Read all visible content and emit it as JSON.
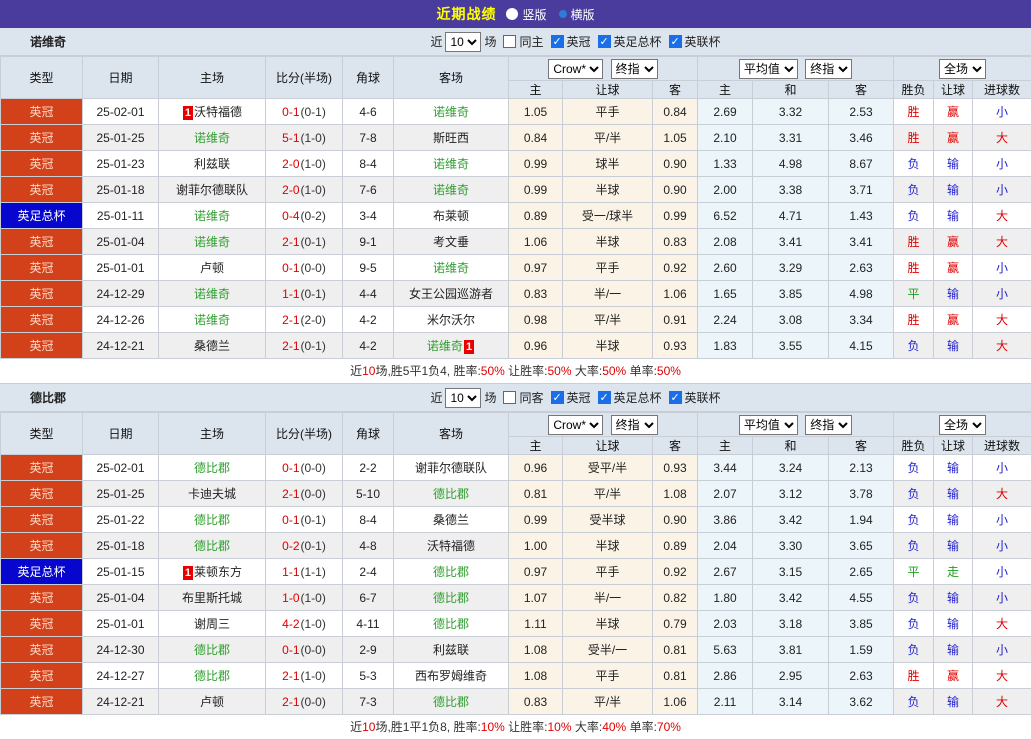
{
  "colors": {
    "topbar_purple": "#4a3c9c",
    "title_yellow": "#ffff00",
    "league_badge": "#d2411a",
    "cup_badge": "#0606cf",
    "self_team_green": "#2f9e2f",
    "win_red": "#e00000",
    "lose_blue": "#2222cc",
    "draw_green": "#1f9e1f",
    "header_bg": "#dce4ee",
    "asia_col_bg": "#fbf4e6",
    "euro_col_bg": "#ecf5f9"
  },
  "topbar": {
    "title": "近期战绩",
    "radios": [
      {
        "label": "竖版",
        "checked": false
      },
      {
        "label": "横版",
        "checked": true
      }
    ]
  },
  "tables": [
    {
      "team": "诺维奇",
      "filter": {
        "near": "近",
        "count": "10",
        "unit": "场",
        "same": "同主",
        "leagues": [
          "英冠",
          "英足总杯",
          "英联杯"
        ]
      },
      "dropdowns": [
        "Crow*",
        "终指",
        "平均值",
        "终指",
        "全场"
      ],
      "main_headers": [
        "类型",
        "日期",
        "主场",
        "比分(半场)",
        "角球",
        "客场"
      ],
      "sub_headers": [
        "主",
        "让球",
        "客",
        "主",
        "和",
        "客",
        "胜负",
        "让球",
        "进球数"
      ],
      "rows": [
        {
          "league": "英冠",
          "cup": false,
          "date": "25-02-01",
          "home": {
            "name": "沃特福德",
            "self": false,
            "badge": "1",
            "badge_pos": "before"
          },
          "score": {
            "ft": "0-1",
            "ht": "(0-1)"
          },
          "corner": "4-6",
          "away": {
            "name": "诺维奇",
            "self": true
          },
          "asia": [
            "1.05",
            "平手",
            "0.84"
          ],
          "euro": [
            "2.69",
            "3.32",
            "2.53"
          ],
          "result": [
            "胜",
            "赢",
            "小"
          ]
        },
        {
          "league": "英冠",
          "cup": false,
          "date": "25-01-25",
          "home": {
            "name": "诺维奇",
            "self": true
          },
          "score": {
            "ft": "5-1",
            "ht": "(1-0)"
          },
          "corner": "7-8",
          "away": {
            "name": "斯旺西",
            "self": false
          },
          "asia": [
            "0.84",
            "平/半",
            "1.05"
          ],
          "euro": [
            "2.10",
            "3.31",
            "3.46"
          ],
          "result": [
            "胜",
            "赢",
            "大"
          ]
        },
        {
          "league": "英冠",
          "cup": false,
          "date": "25-01-23",
          "home": {
            "name": "利兹联",
            "self": false
          },
          "score": {
            "ft": "2-0",
            "ht": "(1-0)"
          },
          "corner": "8-4",
          "away": {
            "name": "诺维奇",
            "self": true
          },
          "asia": [
            "0.99",
            "球半",
            "0.90"
          ],
          "euro": [
            "1.33",
            "4.98",
            "8.67"
          ],
          "result": [
            "负",
            "输",
            "小"
          ]
        },
        {
          "league": "英冠",
          "cup": false,
          "date": "25-01-18",
          "home": {
            "name": "谢菲尔德联队",
            "self": false
          },
          "score": {
            "ft": "2-0",
            "ht": "(1-0)"
          },
          "corner": "7-6",
          "away": {
            "name": "诺维奇",
            "self": true
          },
          "asia": [
            "0.99",
            "半球",
            "0.90"
          ],
          "euro": [
            "2.00",
            "3.38",
            "3.71"
          ],
          "result": [
            "负",
            "输",
            "小"
          ]
        },
        {
          "league": "英足总杯",
          "cup": true,
          "date": "25-01-11",
          "home": {
            "name": "诺维奇",
            "self": true
          },
          "score": {
            "ft": "0-4",
            "ht": "(0-2)"
          },
          "corner": "3-4",
          "away": {
            "name": "布莱顿",
            "self": false
          },
          "asia": [
            "0.89",
            "受一/球半",
            "0.99"
          ],
          "euro": [
            "6.52",
            "4.71",
            "1.43"
          ],
          "result": [
            "负",
            "输",
            "大"
          ]
        },
        {
          "league": "英冠",
          "cup": false,
          "date": "25-01-04",
          "home": {
            "name": "诺维奇",
            "self": true
          },
          "score": {
            "ft": "2-1",
            "ht": "(0-1)"
          },
          "corner": "9-1",
          "away": {
            "name": "考文垂",
            "self": false
          },
          "asia": [
            "1.06",
            "半球",
            "0.83"
          ],
          "euro": [
            "2.08",
            "3.41",
            "3.41"
          ],
          "result": [
            "胜",
            "赢",
            "大"
          ]
        },
        {
          "league": "英冠",
          "cup": false,
          "date": "25-01-01",
          "home": {
            "name": "卢顿",
            "self": false
          },
          "score": {
            "ft": "0-1",
            "ht": "(0-0)"
          },
          "corner": "9-5",
          "away": {
            "name": "诺维奇",
            "self": true
          },
          "asia": [
            "0.97",
            "平手",
            "0.92"
          ],
          "euro": [
            "2.60",
            "3.29",
            "2.63"
          ],
          "result": [
            "胜",
            "赢",
            "小"
          ]
        },
        {
          "league": "英冠",
          "cup": false,
          "date": "24-12-29",
          "home": {
            "name": "诺维奇",
            "self": true
          },
          "score": {
            "ft": "1-1",
            "ht": "(0-1)"
          },
          "corner": "4-4",
          "away": {
            "name": "女王公园巡游者",
            "self": false
          },
          "asia": [
            "0.83",
            "半/一",
            "1.06"
          ],
          "euro": [
            "1.65",
            "3.85",
            "4.98"
          ],
          "result": [
            "平",
            "输",
            "小"
          ]
        },
        {
          "league": "英冠",
          "cup": false,
          "date": "24-12-26",
          "home": {
            "name": "诺维奇",
            "self": true
          },
          "score": {
            "ft": "2-1",
            "ht": "(2-0)"
          },
          "corner": "4-2",
          "away": {
            "name": "米尔沃尔",
            "self": false
          },
          "asia": [
            "0.98",
            "平/半",
            "0.91"
          ],
          "euro": [
            "2.24",
            "3.08",
            "3.34"
          ],
          "result": [
            "胜",
            "赢",
            "大"
          ]
        },
        {
          "league": "英冠",
          "cup": false,
          "date": "24-12-21",
          "home": {
            "name": "桑德兰",
            "self": false
          },
          "score": {
            "ft": "2-1",
            "ht": "(0-1)"
          },
          "corner": "4-2",
          "away": {
            "name": "诺维奇",
            "self": true,
            "badge": "1",
            "badge_pos": "after"
          },
          "asia": [
            "0.96",
            "半球",
            "0.93"
          ],
          "euro": [
            "1.83",
            "3.55",
            "4.15"
          ],
          "result": [
            "负",
            "输",
            "大"
          ]
        }
      ],
      "summary": [
        {
          "text": "近",
          "red": false
        },
        {
          "text": "10",
          "red": true
        },
        {
          "text": "场,胜5平1负4, 胜率:",
          "red": false
        },
        {
          "text": "50%",
          "red": true
        },
        {
          "text": " 让胜率:",
          "red": false
        },
        {
          "text": "50%",
          "red": true
        },
        {
          "text": " 大率:",
          "red": false
        },
        {
          "text": "50%",
          "red": true
        },
        {
          "text": " 单率:",
          "red": false
        },
        {
          "text": "50%",
          "red": true
        }
      ]
    },
    {
      "team": "德比郡",
      "filter": {
        "near": "近",
        "count": "10",
        "unit": "场",
        "same": "同客",
        "leagues": [
          "英冠",
          "英足总杯",
          "英联杯"
        ]
      },
      "dropdowns": [
        "Crow*",
        "终指",
        "平均值",
        "终指",
        "全场"
      ],
      "main_headers": [
        "类型",
        "日期",
        "主场",
        "比分(半场)",
        "角球",
        "客场"
      ],
      "sub_headers": [
        "主",
        "让球",
        "客",
        "主",
        "和",
        "客",
        "胜负",
        "让球",
        "进球数"
      ],
      "rows": [
        {
          "league": "英冠",
          "cup": false,
          "date": "25-02-01",
          "home": {
            "name": "德比郡",
            "self": true
          },
          "score": {
            "ft": "0-1",
            "ht": "(0-0)"
          },
          "corner": "2-2",
          "away": {
            "name": "谢菲尔德联队",
            "self": false
          },
          "asia": [
            "0.96",
            "受平/半",
            "0.93"
          ],
          "euro": [
            "3.44",
            "3.24",
            "2.13"
          ],
          "result": [
            "负",
            "输",
            "小"
          ]
        },
        {
          "league": "英冠",
          "cup": false,
          "date": "25-01-25",
          "home": {
            "name": "卡迪夫城",
            "self": false
          },
          "score": {
            "ft": "2-1",
            "ht": "(0-0)"
          },
          "corner": "5-10",
          "away": {
            "name": "德比郡",
            "self": true
          },
          "asia": [
            "0.81",
            "平/半",
            "1.08"
          ],
          "euro": [
            "2.07",
            "3.12",
            "3.78"
          ],
          "result": [
            "负",
            "输",
            "大"
          ]
        },
        {
          "league": "英冠",
          "cup": false,
          "date": "25-01-22",
          "home": {
            "name": "德比郡",
            "self": true
          },
          "score": {
            "ft": "0-1",
            "ht": "(0-1)"
          },
          "corner": "8-4",
          "away": {
            "name": "桑德兰",
            "self": false
          },
          "asia": [
            "0.99",
            "受半球",
            "0.90"
          ],
          "euro": [
            "3.86",
            "3.42",
            "1.94"
          ],
          "result": [
            "负",
            "输",
            "小"
          ]
        },
        {
          "league": "英冠",
          "cup": false,
          "date": "25-01-18",
          "home": {
            "name": "德比郡",
            "self": true
          },
          "score": {
            "ft": "0-2",
            "ht": "(0-1)"
          },
          "corner": "4-8",
          "away": {
            "name": "沃特福德",
            "self": false
          },
          "asia": [
            "1.00",
            "半球",
            "0.89"
          ],
          "euro": [
            "2.04",
            "3.30",
            "3.65"
          ],
          "result": [
            "负",
            "输",
            "小"
          ]
        },
        {
          "league": "英足总杯",
          "cup": true,
          "date": "25-01-15",
          "home": {
            "name": "莱顿东方",
            "self": false,
            "badge": "1",
            "badge_pos": "before"
          },
          "score": {
            "ft": "1-1",
            "ht": "(1-1)"
          },
          "corner": "2-4",
          "away": {
            "name": "德比郡",
            "self": true
          },
          "asia": [
            "0.97",
            "平手",
            "0.92"
          ],
          "euro": [
            "2.67",
            "3.15",
            "2.65"
          ],
          "result": [
            "平",
            "走",
            "小"
          ]
        },
        {
          "league": "英冠",
          "cup": false,
          "date": "25-01-04",
          "home": {
            "name": "布里斯托城",
            "self": false
          },
          "score": {
            "ft": "1-0",
            "ht": "(1-0)"
          },
          "corner": "6-7",
          "away": {
            "name": "德比郡",
            "self": true
          },
          "asia": [
            "1.07",
            "半/一",
            "0.82"
          ],
          "euro": [
            "1.80",
            "3.42",
            "4.55"
          ],
          "result": [
            "负",
            "输",
            "小"
          ]
        },
        {
          "league": "英冠",
          "cup": false,
          "date": "25-01-01",
          "home": {
            "name": "谢周三",
            "self": false
          },
          "score": {
            "ft": "4-2",
            "ht": "(1-0)"
          },
          "corner": "4-11",
          "away": {
            "name": "德比郡",
            "self": true
          },
          "asia": [
            "1.11",
            "半球",
            "0.79"
          ],
          "euro": [
            "2.03",
            "3.18",
            "3.85"
          ],
          "result": [
            "负",
            "输",
            "大"
          ]
        },
        {
          "league": "英冠",
          "cup": false,
          "date": "24-12-30",
          "home": {
            "name": "德比郡",
            "self": true
          },
          "score": {
            "ft": "0-1",
            "ht": "(0-0)"
          },
          "corner": "2-9",
          "away": {
            "name": "利兹联",
            "self": false
          },
          "asia": [
            "1.08",
            "受半/一",
            "0.81"
          ],
          "euro": [
            "5.63",
            "3.81",
            "1.59"
          ],
          "result": [
            "负",
            "输",
            "小"
          ]
        },
        {
          "league": "英冠",
          "cup": false,
          "date": "24-12-27",
          "home": {
            "name": "德比郡",
            "self": true
          },
          "score": {
            "ft": "2-1",
            "ht": "(1-0)"
          },
          "corner": "5-3",
          "away": {
            "name": "西布罗姆维奇",
            "self": false
          },
          "asia": [
            "1.08",
            "平手",
            "0.81"
          ],
          "euro": [
            "2.86",
            "2.95",
            "2.63"
          ],
          "result": [
            "胜",
            "赢",
            "大"
          ]
        },
        {
          "league": "英冠",
          "cup": false,
          "date": "24-12-21",
          "home": {
            "name": "卢顿",
            "self": false
          },
          "score": {
            "ft": "2-1",
            "ht": "(0-0)"
          },
          "corner": "7-3",
          "away": {
            "name": "德比郡",
            "self": true
          },
          "asia": [
            "0.83",
            "平/半",
            "1.06"
          ],
          "euro": [
            "2.11",
            "3.14",
            "3.62"
          ],
          "result": [
            "负",
            "输",
            "大"
          ]
        }
      ],
      "summary": [
        {
          "text": "近",
          "red": false
        },
        {
          "text": "10",
          "red": true
        },
        {
          "text": "场,胜1平1负8, 胜率:",
          "red": false
        },
        {
          "text": "10%",
          "red": true
        },
        {
          "text": " 让胜率:",
          "red": false
        },
        {
          "text": "10%",
          "red": true
        },
        {
          "text": " 大率:",
          "red": false
        },
        {
          "text": "40%",
          "red": true
        },
        {
          "text": " 单率:",
          "red": false
        },
        {
          "text": "70%",
          "red": true
        }
      ]
    }
  ]
}
